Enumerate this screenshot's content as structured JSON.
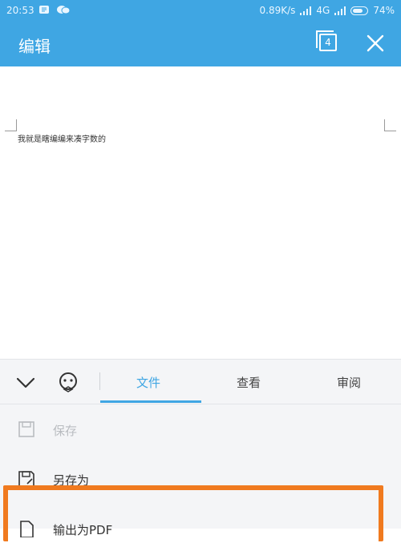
{
  "status": {
    "time": "20:53",
    "net_speed": "0.89K/s",
    "network": "4G",
    "battery": "74%",
    "battery_level": 0.74
  },
  "header": {
    "title": "编辑",
    "tab_count": "4"
  },
  "document": {
    "text": "我就是瞎编编来凑字数的"
  },
  "panel": {
    "tabs": [
      {
        "label": "文件",
        "active": true
      },
      {
        "label": "查看",
        "active": false
      },
      {
        "label": "审阅",
        "active": false
      }
    ],
    "menu": [
      {
        "label": "保存",
        "icon": "save-icon",
        "enabled": false
      },
      {
        "label": "另存为",
        "icon": "save-as-icon",
        "enabled": true
      },
      {
        "label": "输出为PDF",
        "icon": "pdf-export-icon",
        "enabled": true
      }
    ]
  },
  "colors": {
    "accent": "#3fa6e3",
    "highlight": "#f07a1f"
  }
}
